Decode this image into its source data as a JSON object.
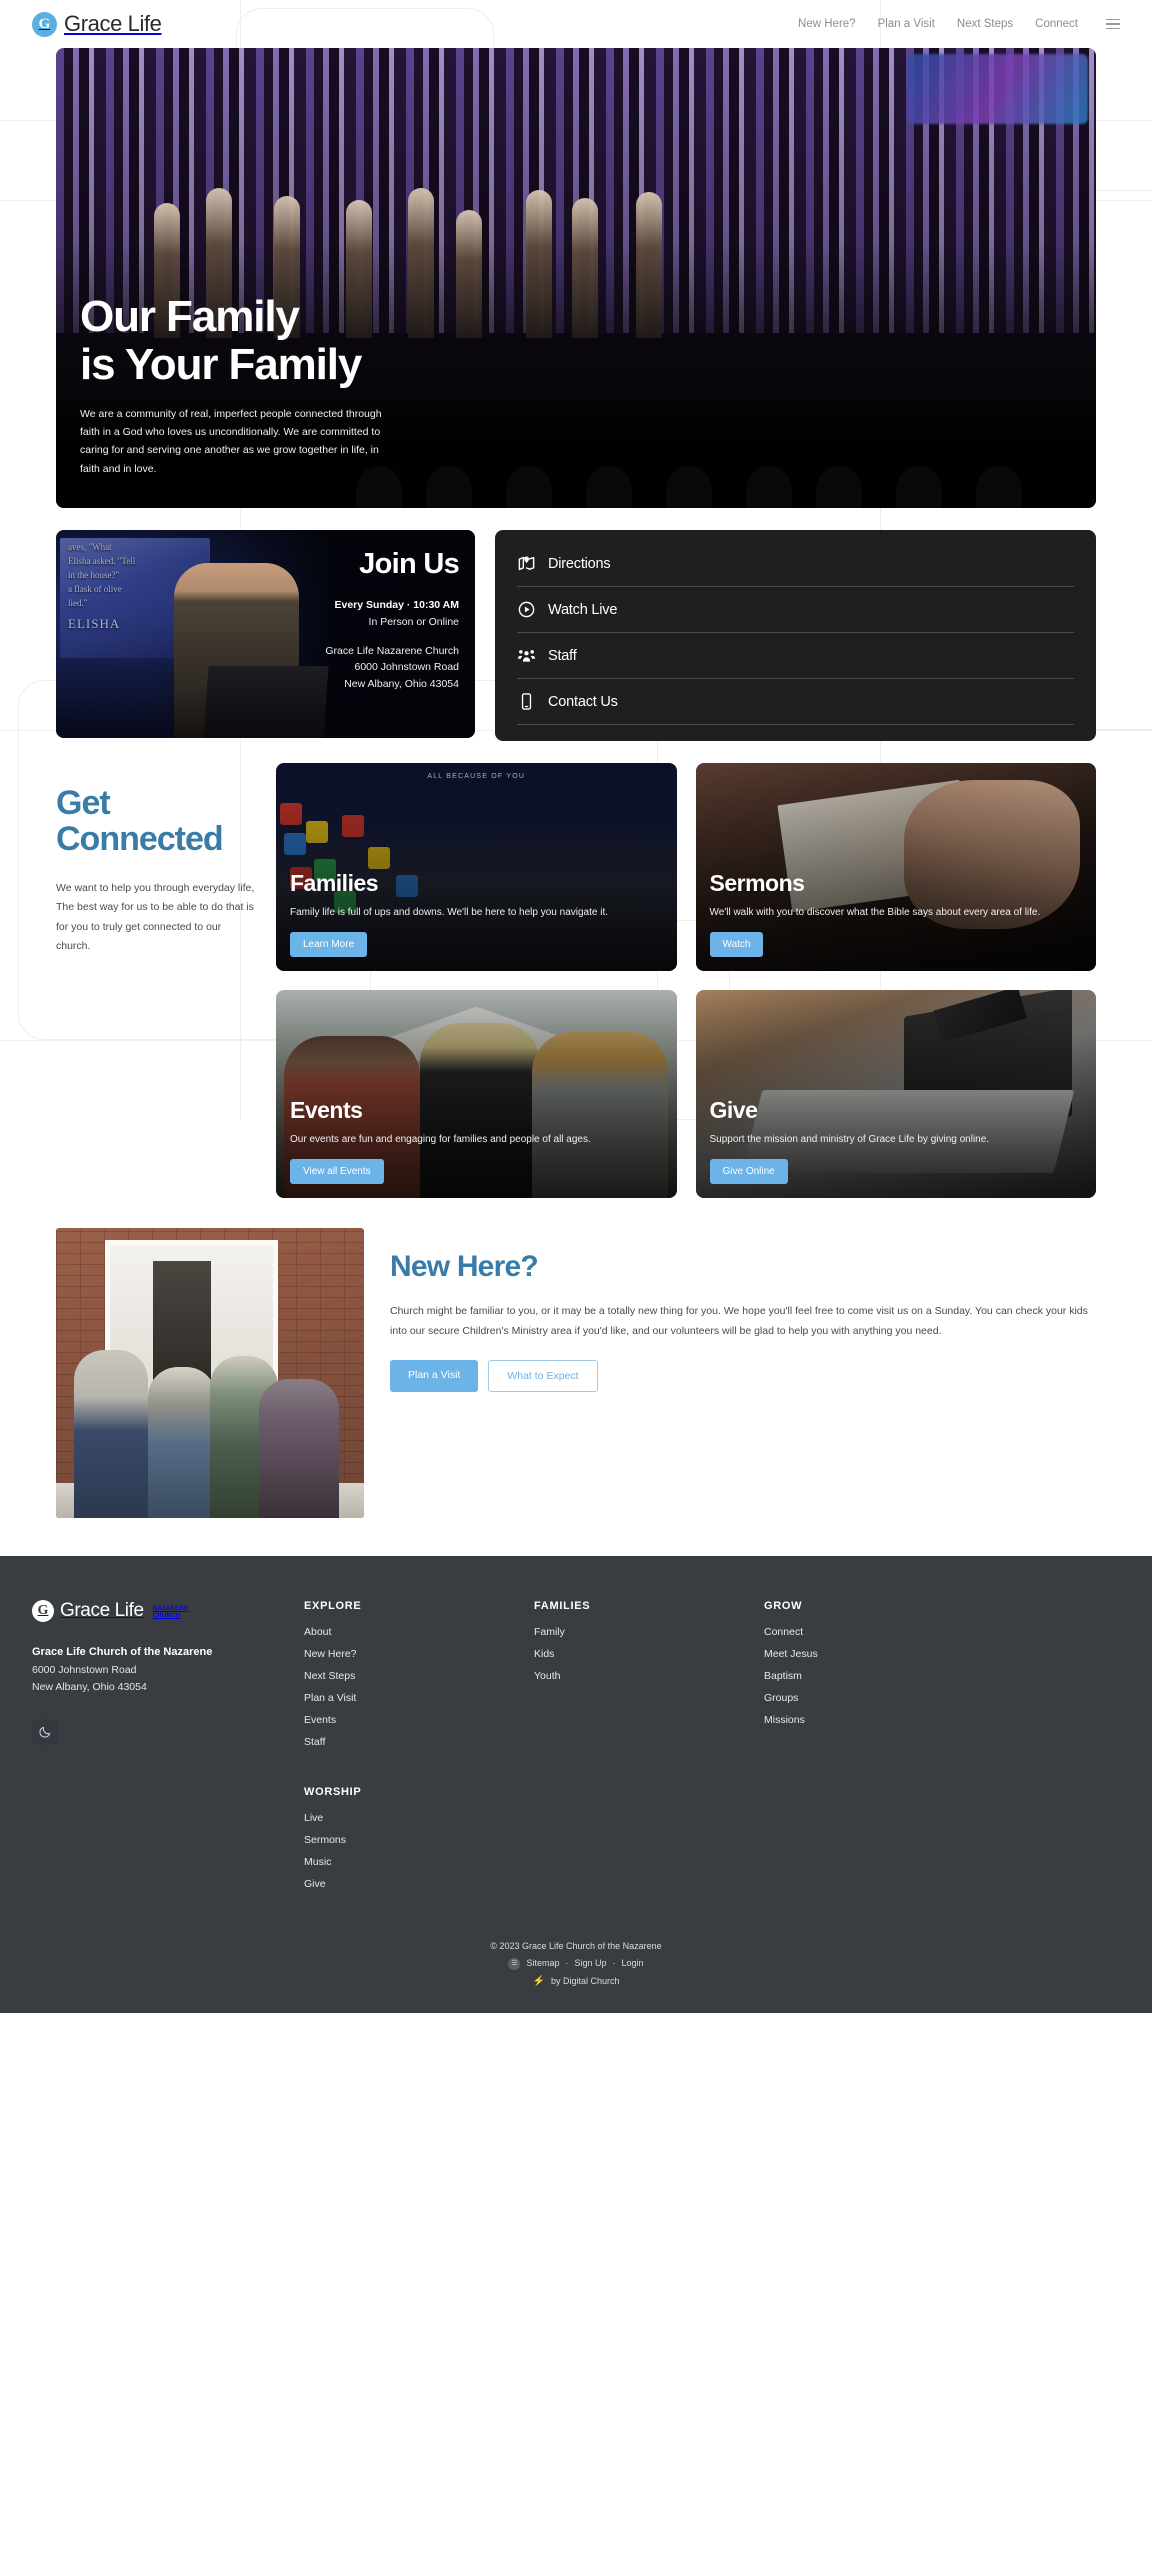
{
  "brand": {
    "name": "Grace Life",
    "mark": "G"
  },
  "nav": {
    "items": [
      {
        "label": "New Here?"
      },
      {
        "label": "Plan a Visit"
      },
      {
        "label": "Next Steps"
      },
      {
        "label": "Connect"
      }
    ],
    "menu_icon": "hamburger-icon"
  },
  "hero": {
    "title_line1": "Our Family",
    "title_line2": "is Your Family",
    "paragraph": "We are a community of real, imperfect people connected through faith in a God who loves us unconditionally. We are committed to caring for and serving one another as we grow together in life, in faith and in love."
  },
  "join": {
    "heading": "Join Us",
    "time": "Every Sunday · 10:30 AM",
    "mode": "In Person or Online",
    "church": "Grace Life Nazarene Church",
    "street": "6000 Johnstown Road",
    "city": "New Albany, Ohio 43054",
    "slide_text": "ELISHA"
  },
  "quick_links": [
    {
      "label": "Directions",
      "icon": "map-pin-icon"
    },
    {
      "label": "Watch Live",
      "icon": "play-circle-icon"
    },
    {
      "label": "Staff",
      "icon": "people-group-icon"
    },
    {
      "label": "Contact Us",
      "icon": "mobile-phone-icon"
    }
  ],
  "connect": {
    "heading_line1": "Get",
    "heading_line2": "Connected",
    "paragraph": "We want to help you through everyday life, The best way for us to be able to do that is for you to truly get connected to our church.",
    "cards": [
      {
        "title": "Families",
        "text": "Family life is full of ups and downs. We'll be here to help you navigate it.",
        "button": "Learn More",
        "art": "art-families",
        "banner": "ALL BECAUSE OF YOU"
      },
      {
        "title": "Sermons",
        "text": "We'll walk with you to discover what the Bible says about every area of life.",
        "button": "Watch",
        "art": "art-sermons",
        "banner": ""
      },
      {
        "title": "Events",
        "text": "Our events are fun and engaging for families and people of all ages.",
        "button": "View all Events",
        "art": "art-events",
        "banner": ""
      },
      {
        "title": "Give",
        "text": "Support the mission and ministry of Grace Life by giving online.",
        "button": "Give Online",
        "art": "art-give",
        "banner": ""
      }
    ]
  },
  "new_here": {
    "heading": "New Here?",
    "paragraph": "Church might be familiar to you, or it may be a totally new thing for you. We hope you'll feel free to come visit us on a Sunday. You can check your kids into our secure Children's Ministry area if you'd like, and our volunteers will be glad to help you with anything you need.",
    "primary_button": "Plan a Visit",
    "secondary_button": "What to Expect"
  },
  "footer": {
    "brand_name": "Grace Life",
    "brand_tag_line1": "NAZARENE",
    "brand_tag_line2": "CHURCH",
    "church_name": "Grace Life Church of the Nazarene",
    "street": "6000 Johnstown Road",
    "city": "New Albany, Ohio 43054",
    "theme_toggle_icon": "moon-icon",
    "columns": [
      {
        "heading": "EXPLORE",
        "links": [
          "About",
          "New Here?",
          "Next Steps",
          "Plan a Visit",
          "Events",
          "Staff"
        ]
      },
      {
        "heading": "FAMILIES",
        "links": [
          "Family",
          "Kids",
          "Youth"
        ]
      },
      {
        "heading": "GROW",
        "links": [
          "Connect",
          "Meet Jesus",
          "Baptism",
          "Groups",
          "Missions"
        ]
      }
    ],
    "worship": {
      "heading": "WORSHIP",
      "links": [
        "Live",
        "Sermons",
        "Music",
        "Give"
      ]
    },
    "copyright": "© 2023 Grace Life Church of the Nazarene",
    "sitemap": "Sitemap",
    "signup": "Sign Up",
    "login": "Login",
    "sep": "·",
    "credit": "by Digital Church",
    "credit_icon": "lightning-bolt-icon",
    "sitemap_icon": "sitemap-icon"
  },
  "colors": {
    "accent_blue": "#6cb3e8",
    "heading_blue": "#3a7ca8",
    "footer_bg": "#393d42",
    "panel_dark": "#201f1d"
  }
}
